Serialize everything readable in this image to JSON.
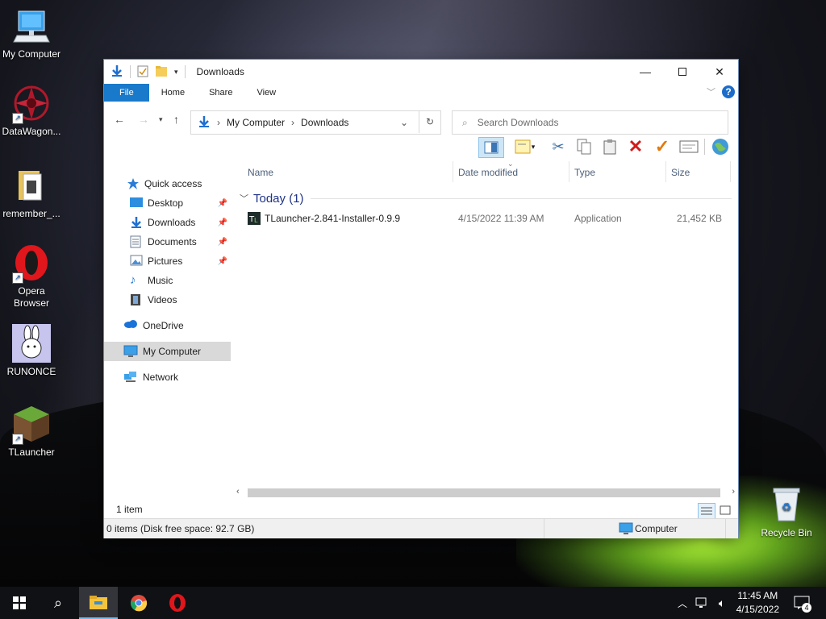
{
  "desktop": {
    "icons": [
      {
        "label": "My Computer"
      },
      {
        "label": "DataWagon..."
      },
      {
        "label": "remember_..."
      },
      {
        "label": "Opera Browser"
      },
      {
        "label": "RUNONCE"
      },
      {
        "label": "TLauncher"
      },
      {
        "label": "Recycle Bin"
      }
    ]
  },
  "window": {
    "title": "Downloads",
    "ribbon_tabs": [
      "File",
      "Home",
      "Share",
      "View"
    ],
    "help_label": "?",
    "address": {
      "root": "My Computer",
      "current": "Downloads"
    },
    "search": {
      "placeholder": "Search Downloads"
    },
    "nav_pane": {
      "quick_access": "Quick access",
      "items": [
        "Desktop",
        "Downloads",
        "Documents",
        "Pictures",
        "Music",
        "Videos"
      ],
      "onedrive": "OneDrive",
      "this_pc": "My Computer",
      "network": "Network"
    },
    "columns": {
      "name": "Name",
      "date": "Date modified",
      "type": "Type",
      "size": "Size"
    },
    "group": {
      "label": "Today (1)"
    },
    "files": [
      {
        "name": "TLauncher-2.841-Installer-0.9.9",
        "date": "4/15/2022 11:39 AM",
        "type": "Application",
        "size": "21,452 KB"
      }
    ],
    "status": {
      "item_count": "1 item",
      "details": "0 items (Disk free space: 92.7 GB)",
      "location": "Computer"
    }
  },
  "taskbar": {
    "time": "11:45 AM",
    "date": "4/15/2022",
    "notifications": "4"
  },
  "colors": {
    "accent": "#1979ca",
    "selection": "#d9d9d9"
  }
}
